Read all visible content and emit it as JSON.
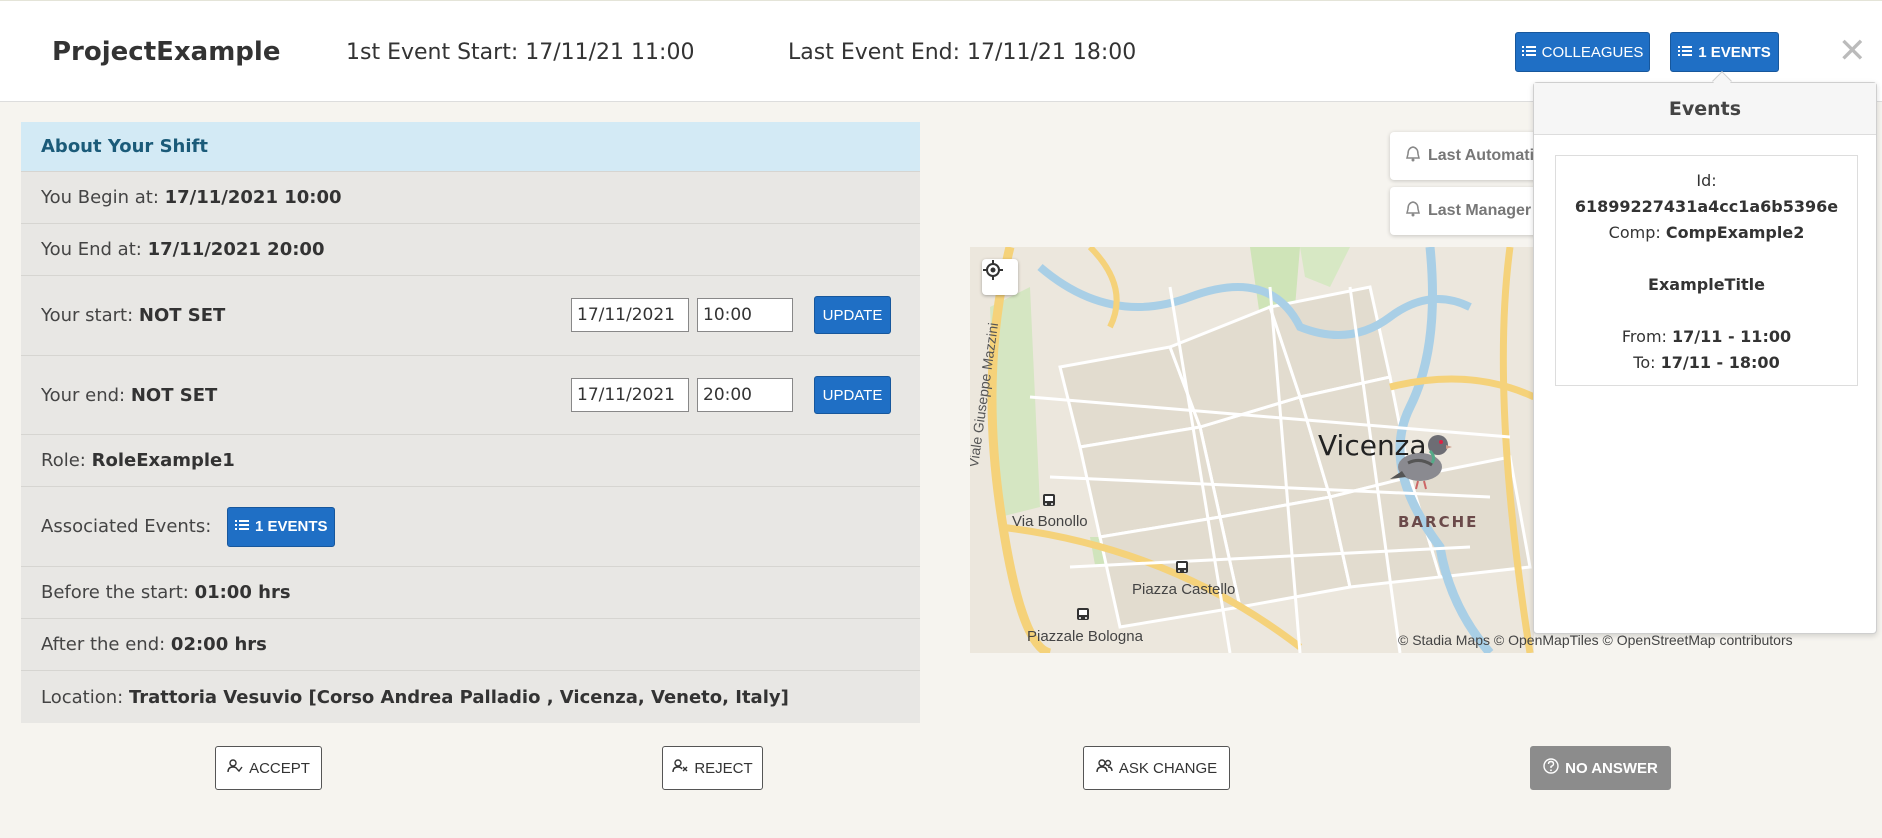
{
  "header": {
    "project_name": "ProjectExample",
    "first_event_start": "1st Event Start: 17/11/21 11:00",
    "last_event_end": "Last Event End: 17/11/21 18:00",
    "colleagues_label": "COLLEAGUES",
    "events_label": "1 EVENTS",
    "close_glyph": "✕"
  },
  "shift": {
    "title": "About Your Shift",
    "begin_label": "You Begin at: ",
    "begin_value": "17/11/2021 10:00",
    "end_label": "You End at: ",
    "end_value": "17/11/2021 20:00",
    "start_label": "Your start: ",
    "start_value": "NOT SET",
    "start_date": "17/11/2021",
    "start_time": "10:00",
    "end2_label": "Your end: ",
    "end2_value": "NOT SET",
    "end_date": "17/11/2021",
    "end_time": "20:00",
    "update_label": "UPDATE",
    "role_label": "Role: ",
    "role_value": "RoleExample1",
    "assoc_label": "Associated Events:",
    "assoc_button": "1 EVENTS",
    "before_label": "Before the start: ",
    "before_value": "01:00 hrs",
    "after_label": "After the end: ",
    "after_value": "02:00 hrs",
    "location_label": "Location: ",
    "location_value": "Trattoria Vesuvio [Corso Andrea Palladio , Vicenza, Veneto, Italy]"
  },
  "map": {
    "city_label": "Vicenza",
    "district_label": "BARCHE",
    "places": [
      "Via Bonollo",
      "Piazza Castello",
      "Piazzale Bologna",
      "Viale Giuseppe Mazzini"
    ],
    "attribution": "© Stadia Maps © OpenMapTiles © OpenStreetMap contributors",
    "notif_automatic": "Last Automati",
    "notif_manager": "Last Manager"
  },
  "events_popover": {
    "title": "Events",
    "id_label": "Id:",
    "id_value": "61899227431a4cc1a6b5396e",
    "comp_label": "Comp: ",
    "comp_value": "CompExample2",
    "event_title": "ExampleTitle",
    "from_label": "From: ",
    "from_value": "17/11 - 11:00",
    "to_label": "To: ",
    "to_value": "17/11 - 18:00"
  },
  "actions": {
    "accept": "ACCEPT",
    "reject": "REJECT",
    "ask_change": "ASK CHANGE",
    "no_answer": "NO ANSWER"
  },
  "colors": {
    "primary": "#1f6fc5",
    "panel_title_bg": "#d3eaf5",
    "panel_bg": "#e8e7e4",
    "page_bg": "#f6f4ef",
    "no_answer_bg": "#8c8c8c"
  },
  "icons": [
    "list-icon",
    "close-icon",
    "locate-icon",
    "bell-icon",
    "user-check-icon",
    "user-x-icon",
    "users-icon",
    "question-circle-icon",
    "bus-stop-icon",
    "pigeon-marker-icon"
  ]
}
